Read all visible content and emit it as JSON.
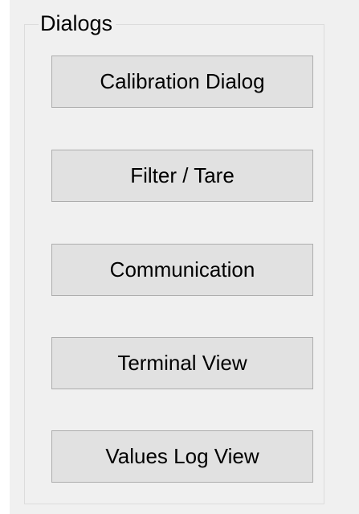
{
  "dialogs_group": {
    "title": "Dialogs",
    "buttons": [
      {
        "label": "Calibration Dialog"
      },
      {
        "label": "Filter / Tare"
      },
      {
        "label": "Communication"
      },
      {
        "label": "Terminal View"
      },
      {
        "label": "Values Log View"
      }
    ]
  }
}
